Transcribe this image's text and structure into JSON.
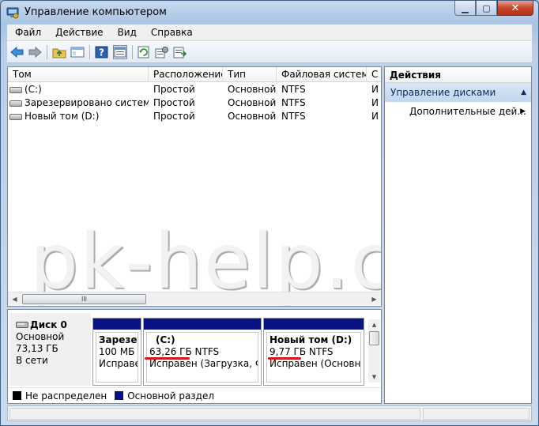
{
  "window": {
    "title": "Управление компьютером",
    "minimize_glyph": "▁",
    "maximize_glyph": "▢",
    "close_glyph": "✕"
  },
  "menu": [
    "Файл",
    "Действие",
    "Вид",
    "Справка"
  ],
  "toolbar_icons": [
    "back-arrow-icon",
    "forward-arrow-icon",
    "folder-up-icon",
    "console-tree-icon",
    "help-icon",
    "view-pane-icon",
    "refresh-icon",
    "properties-icon",
    "export-icon"
  ],
  "volumes": {
    "columns": [
      "Том",
      "Расположение",
      "Тип",
      "Файловая система",
      "С"
    ],
    "rows": [
      {
        "name": "(C:)",
        "layout": "Простой",
        "type": "Основной",
        "fs": "NTFS",
        "status": "И"
      },
      {
        "name": "Зарезервировано системой",
        "layout": "Простой",
        "type": "Основной",
        "fs": "NTFS",
        "status": "И"
      },
      {
        "name": "Новый том (D:)",
        "layout": "Простой",
        "type": "Основной",
        "fs": "NTFS",
        "status": "И"
      }
    ]
  },
  "watermark": "pk-help.com",
  "scroll_glyphs": {
    "left": "◀",
    "right": "▶",
    "grip": "III",
    "up": "▲",
    "down": "▼"
  },
  "disk": {
    "name": "Диск 0",
    "type": "Основной",
    "size": "73,13 ГБ",
    "status": "В сети",
    "partitions": [
      {
        "title": "Зарезер",
        "size": "100 МБ N",
        "health": "Исправе"
      },
      {
        "title": "(C:)",
        "size": "63,26 ГБ NTFS",
        "health": "Исправен (Загрузка, Фай"
      },
      {
        "title": "Новый том  (D:)",
        "size": "9,77 ГБ NTFS",
        "health": "Исправен (Основноі"
      }
    ]
  },
  "legend": [
    {
      "label": "Не распределен",
      "color": "#000000"
    },
    {
      "label": "Основной раздел",
      "color": "#0a1182"
    }
  ],
  "actions": {
    "header": "Действия",
    "section": "Управление дисками",
    "section_glyph": "▲",
    "item": "Дополнительные дей...",
    "item_glyph": "▶"
  },
  "colors": {
    "primary_partition": "#0a1182",
    "highlight_underline": "#d8141b"
  }
}
